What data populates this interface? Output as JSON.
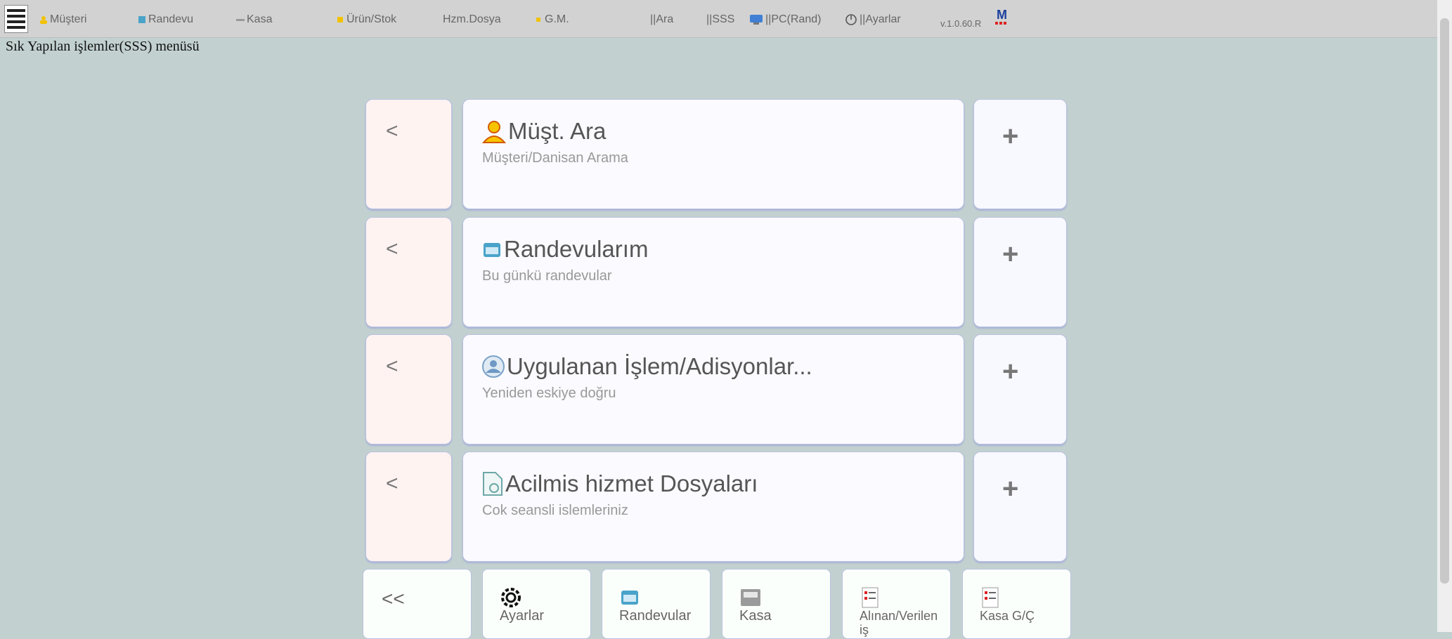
{
  "nav": {
    "items": [
      {
        "label": "Müşteri",
        "icon": "person-icon"
      },
      {
        "label": "Randevu",
        "icon": "calendar-icon"
      },
      {
        "label": "Kasa",
        "icon": "cash-icon"
      },
      {
        "label": "Ürün/Stok",
        "icon": "box-icon"
      },
      {
        "label": "Hzm.Dosya",
        "icon": "file-icon"
      },
      {
        "label": "G.M.",
        "icon": "star-icon"
      },
      {
        "label": "||Ara",
        "icon": ""
      },
      {
        "label": "||SSS",
        "icon": ""
      },
      {
        "label": "||PC(Rand)",
        "icon": "monitor-icon"
      },
      {
        "label": "||Ayarlar",
        "icon": "power-icon"
      }
    ],
    "version": "v.1.0.60.R",
    "logo_letter": "M"
  },
  "page": {
    "title": "Sık Yapılan işlemler(SSS) menüsü"
  },
  "cards": [
    {
      "title": "Müşt. Ara",
      "subtitle": "Müşteri/Danisan Arama",
      "icon": "person-icon",
      "left_label": "<",
      "right_label": "+"
    },
    {
      "title": "Randevularım",
      "subtitle": "Bu günkü randevular",
      "icon": "calendar-icon",
      "left_label": "<",
      "right_label": "+"
    },
    {
      "title": "Uygulanan İşlem/Adisyonlar...",
      "subtitle": "Yeniden eskiye doğru",
      "icon": "globe-icon",
      "left_label": "<",
      "right_label": "+"
    },
    {
      "title": "Acilmis hizmet Dosyaları",
      "subtitle": "Cok seansli islemleriniz",
      "icon": "file-icon",
      "left_label": "<",
      "right_label": "+"
    }
  ],
  "tiles": [
    {
      "label": "<<",
      "icon": ""
    },
    {
      "label": "Ayarlar",
      "icon": "gear-icon"
    },
    {
      "label": "Randevular",
      "icon": "calendar-icon"
    },
    {
      "label": "Kasa",
      "icon": "cash-register-icon"
    },
    {
      "label": "Alınan/Verilen iş",
      "icon": "list-icon"
    },
    {
      "label": "Kasa G/Ç",
      "icon": "list-icon"
    }
  ],
  "colors": {
    "background": "#c2d1d0",
    "topbar": "#d2d2d2",
    "card_left": "#fff3f2",
    "card_mid": "#fafaff",
    "accent_yellow": "#f2c200",
    "accent_blue": "#4aa3c9"
  }
}
